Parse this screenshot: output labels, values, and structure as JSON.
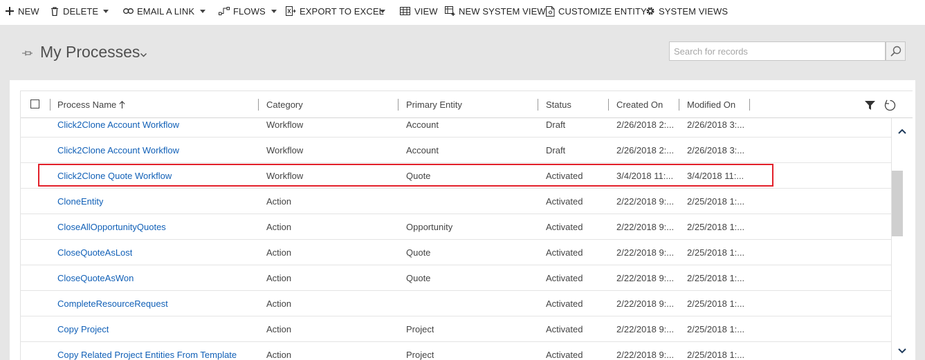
{
  "toolbar": {
    "new_label": "NEW",
    "delete_label": "DELETE",
    "email_link_label": "EMAIL A LINK",
    "flows_label": "FLOWS",
    "export_excel_label": "EXPORT TO EXCEL",
    "view_label": "VIEW",
    "new_system_view_label": "NEW SYSTEM VIEW",
    "customize_entity_label": "CUSTOMIZE ENTITY",
    "system_views_label": "SYSTEM VIEWS"
  },
  "header": {
    "title": "My Processes",
    "search_placeholder": "Search for records"
  },
  "grid": {
    "columns": [
      "Process Name",
      "Category",
      "Primary Entity",
      "Status",
      "Created On",
      "Modified On"
    ],
    "rows": [
      {
        "name": "Click2Clone Account Workflow",
        "category": "Workflow",
        "entity": "Account",
        "status": "Draft",
        "created": "2/26/2018 2:...",
        "modified": "2/26/2018 3:..."
      },
      {
        "name": "Click2Clone Account Workflow",
        "category": "Workflow",
        "entity": "Account",
        "status": "Draft",
        "created": "2/26/2018 2:...",
        "modified": "2/26/2018 3:..."
      },
      {
        "name": "Click2Clone Quote Workflow",
        "category": "Workflow",
        "entity": "Quote",
        "status": "Activated",
        "created": "3/4/2018 11:...",
        "modified": "3/4/2018 11:..."
      },
      {
        "name": "CloneEntity",
        "category": "Action",
        "entity": "",
        "status": "Activated",
        "created": "2/22/2018 9:...",
        "modified": "2/25/2018 1:..."
      },
      {
        "name": "CloseAllOpportunityQuotes",
        "category": "Action",
        "entity": "Opportunity",
        "status": "Activated",
        "created": "2/22/2018 9:...",
        "modified": "2/25/2018 1:..."
      },
      {
        "name": "CloseQuoteAsLost",
        "category": "Action",
        "entity": "Quote",
        "status": "Activated",
        "created": "2/22/2018 9:...",
        "modified": "2/25/2018 1:..."
      },
      {
        "name": "CloseQuoteAsWon",
        "category": "Action",
        "entity": "Quote",
        "status": "Activated",
        "created": "2/22/2018 9:...",
        "modified": "2/25/2018 1:..."
      },
      {
        "name": "CompleteResourceRequest",
        "category": "Action",
        "entity": "",
        "status": "Activated",
        "created": "2/22/2018 9:...",
        "modified": "2/25/2018 1:..."
      },
      {
        "name": "Copy Project",
        "category": "Action",
        "entity": "Project",
        "status": "Activated",
        "created": "2/22/2018 9:...",
        "modified": "2/25/2018 1:..."
      },
      {
        "name": "Copy Related Project Entities From Template",
        "category": "Action",
        "entity": "Project",
        "status": "Activated",
        "created": "2/22/2018 9:...",
        "modified": "2/25/2018 1:..."
      }
    ]
  },
  "colors": {
    "link": "#1160b7",
    "highlight": "#e2202a",
    "header_band": "#e6e6e6"
  },
  "icons": {
    "new": "plus-icon",
    "delete": "trash-icon",
    "email_link": "link-icon",
    "flows": "flow-icon",
    "export_excel": "excel-icon",
    "view": "grid-icon",
    "new_system_view": "new-view-icon",
    "customize_entity": "customize-icon",
    "system_views": "gear-icon",
    "filter": "filter-icon",
    "refresh": "refresh-icon"
  }
}
